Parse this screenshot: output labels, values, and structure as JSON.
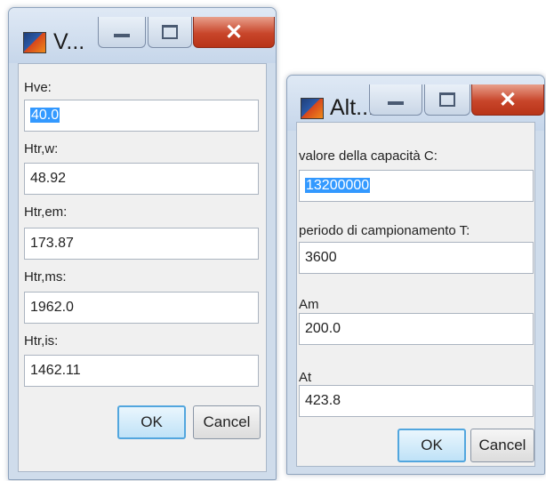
{
  "dialogs": [
    {
      "title": "V...",
      "fields": [
        {
          "label": "Hve:",
          "value": "40.0",
          "selected": true
        },
        {
          "label": "Htr,w:",
          "value": "48.92"
        },
        {
          "label": "Htr,em:",
          "value": "173.87"
        },
        {
          "label": "Htr,ms:",
          "value": "1962.0"
        },
        {
          "label": "Htr,is:",
          "value": "1462.11"
        }
      ],
      "ok_label": "OK",
      "cancel_label": "Cancel"
    },
    {
      "title": "Alt...",
      "fields": [
        {
          "label": "valore della capacità C:",
          "value": "13200000",
          "selected": true
        },
        {
          "label": "periodo di campionamento T:",
          "value": "3600"
        },
        {
          "label": "Am",
          "value": "200.0"
        },
        {
          "label": "At",
          "value": "423.8"
        }
      ],
      "ok_label": "OK",
      "cancel_label": "Cancel"
    }
  ],
  "icons": {
    "app": "matlab-icon",
    "minimize": "minimize-icon",
    "maximize": "maximize-icon",
    "close": "close-icon"
  },
  "colors": {
    "frame": "#cfdceb",
    "selection": "#3399ff",
    "close_button": "#c8452a"
  }
}
